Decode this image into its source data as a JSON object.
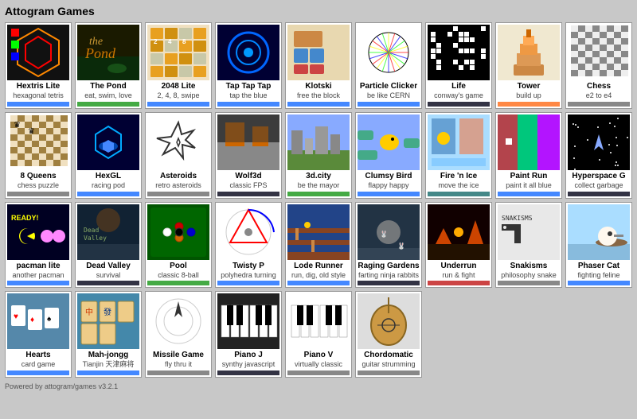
{
  "app": {
    "title": "Attogram Games",
    "footer": "Powered by attogram/games v3.2.1",
    "footer_url": "attogram/games"
  },
  "games": [
    {
      "id": "hextris",
      "title": "Hextris Lite",
      "subtitle": "hexagonal tetris",
      "badge": "badge-blue",
      "thumb": "hextris"
    },
    {
      "id": "pond",
      "title": "The Pond",
      "subtitle": "eat, swim, love",
      "badge": "badge-green",
      "thumb": "pond"
    },
    {
      "id": "2048",
      "title": "2048 Lite",
      "subtitle": "2, 4, 8, swipe",
      "badge": "badge-blue",
      "thumb": "2048"
    },
    {
      "id": "taptap",
      "title": "Tap Tap Tap",
      "subtitle": "tap the blue",
      "badge": "badge-blue",
      "thumb": "tap"
    },
    {
      "id": "klotski",
      "title": "Klotski",
      "subtitle": "free the block",
      "badge": "badge-blue",
      "thumb": "klotski"
    },
    {
      "id": "particle",
      "title": "Particle Clicker",
      "subtitle": "be like CERN",
      "badge": "badge-blue",
      "thumb": "particle"
    },
    {
      "id": "life",
      "title": "Life",
      "subtitle": "conway's game",
      "badge": "badge-dark",
      "thumb": "life"
    },
    {
      "id": "tower",
      "title": "Tower",
      "subtitle": "build up",
      "badge": "badge-orange",
      "thumb": "tower"
    },
    {
      "id": "chess",
      "title": "Chess",
      "subtitle": "e2 to e4",
      "badge": "badge-gray",
      "thumb": "chess"
    },
    {
      "id": "8queens",
      "title": "8 Queens",
      "subtitle": "chess puzzle",
      "badge": "badge-gray",
      "thumb": "8q"
    },
    {
      "id": "hexgl",
      "title": "HexGL",
      "subtitle": "racing pod",
      "badge": "badge-blue",
      "thumb": "hexgl"
    },
    {
      "id": "asteroids",
      "title": "Asteroids",
      "subtitle": "retro asteroids",
      "badge": "badge-gray",
      "thumb": "asteroids"
    },
    {
      "id": "wolf3d",
      "title": "Wolf3d",
      "subtitle": "classic FPS",
      "badge": "badge-dark",
      "thumb": "wolf3d"
    },
    {
      "id": "3dcity",
      "title": "3d.city",
      "subtitle": "be the mayor",
      "badge": "badge-green",
      "thumb": "3dcity"
    },
    {
      "id": "clumsybird",
      "title": "Clumsy Bird",
      "subtitle": "flappy happy",
      "badge": "badge-blue",
      "thumb": "clumsy"
    },
    {
      "id": "firnice",
      "title": "Fire 'n Ice",
      "subtitle": "move the ice",
      "badge": "badge-teal",
      "thumb": "firnice"
    },
    {
      "id": "paintrun",
      "title": "Paint Run",
      "subtitle": "paint it all blue",
      "badge": "badge-blue",
      "thumb": "paintrun"
    },
    {
      "id": "hyperspace",
      "title": "Hyperspace G",
      "subtitle": "collect garbage",
      "badge": "badge-dark",
      "thumb": "hyperspace"
    },
    {
      "id": "pacman",
      "title": "pacman lite",
      "subtitle": "another pacman",
      "badge": "badge-blue",
      "thumb": "pacman"
    },
    {
      "id": "deadvalley",
      "title": "Dead Valley",
      "subtitle": "survival",
      "badge": "badge-dark",
      "thumb": "deadvalley"
    },
    {
      "id": "pool",
      "title": "Pool",
      "subtitle": "classic 8-ball",
      "badge": "badge-green",
      "thumb": "pool"
    },
    {
      "id": "twisty",
      "title": "Twisty P",
      "subtitle": "polyhedra turning",
      "badge": "badge-blue",
      "thumb": "twisty"
    },
    {
      "id": "lode",
      "title": "Lode Runner",
      "subtitle": "run, dig, old style",
      "badge": "badge-blue",
      "thumb": "lode"
    },
    {
      "id": "raging",
      "title": "Raging Gardens",
      "subtitle": "farting ninja rabbits",
      "badge": "badge-dark",
      "thumb": "raging"
    },
    {
      "id": "underrun",
      "title": "Underrun",
      "subtitle": "run & fight",
      "badge": "badge-red",
      "thumb": "underrun"
    },
    {
      "id": "snakisms",
      "title": "Snakisms",
      "subtitle": "philosophy snake",
      "badge": "badge-gray",
      "thumb": "snakisms"
    },
    {
      "id": "phaser",
      "title": "Phaser Cat",
      "subtitle": "fighting feline",
      "badge": "badge-blue",
      "thumb": "phaser"
    },
    {
      "id": "hearts",
      "title": "Hearts",
      "subtitle": "card game",
      "badge": "badge-blue",
      "thumb": "hearts"
    },
    {
      "id": "mahjongg",
      "title": "Mah-jongg",
      "subtitle": "Tianjin 天津麻将",
      "badge": "badge-blue",
      "thumb": "mahjongg"
    },
    {
      "id": "missile",
      "title": "Missile Game",
      "subtitle": "fly thru it",
      "badge": "badge-gray",
      "thumb": "missile"
    },
    {
      "id": "pianoj",
      "title": "Piano J",
      "subtitle": "synthy javascript",
      "badge": "badge-dark",
      "thumb": "pianoj"
    },
    {
      "id": "pianv",
      "title": "Piano V",
      "subtitle": "virtually classic",
      "badge": "badge-gray",
      "thumb": "pianv"
    },
    {
      "id": "chordo",
      "title": "Chordomatic",
      "subtitle": "guitar strumming",
      "badge": "badge-gray",
      "thumb": "chordo"
    }
  ]
}
